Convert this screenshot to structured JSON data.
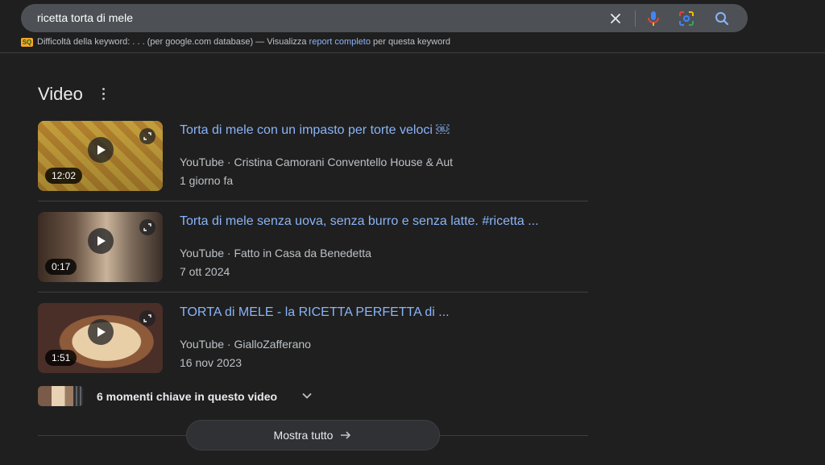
{
  "search": {
    "query": "ricetta torta di mele"
  },
  "keyword_bar": {
    "badge": "SQ",
    "label": "Difficoltà della keyword:",
    "score": ". . .",
    "db": "(per google.com database) — Visualizza",
    "link": "report completo",
    "suffix": "per questa keyword"
  },
  "section": {
    "title": "Video"
  },
  "videos": [
    {
      "title": "Torta di mele con un impasto per torte veloci ￼",
      "source": "YouTube · Cristina Camorani Conventello House & Aut",
      "date": "1 giorno fa",
      "duration": "12:02"
    },
    {
      "title": "Torta di mele senza uova, senza burro e senza latte. #ricetta ...",
      "source": "YouTube · Fatto in Casa da Benedetta",
      "date": "7 ott 2024",
      "duration": "0:17"
    },
    {
      "title": "TORTA di MELE - la RICETTA PERFETTA di ...",
      "source": "YouTube · GialloZafferano",
      "date": "16 nov 2023",
      "duration": "1:51"
    }
  ],
  "key_moments": {
    "label": "6 momenti chiave in questo video"
  },
  "show_all": {
    "label": "Mostra tutto"
  },
  "colors": {
    "background": "#1f1f1f",
    "link": "#8ab4f8",
    "search_box": "#4d5156",
    "mic_blue": "#4285f4",
    "mic_red": "#ea4335"
  }
}
